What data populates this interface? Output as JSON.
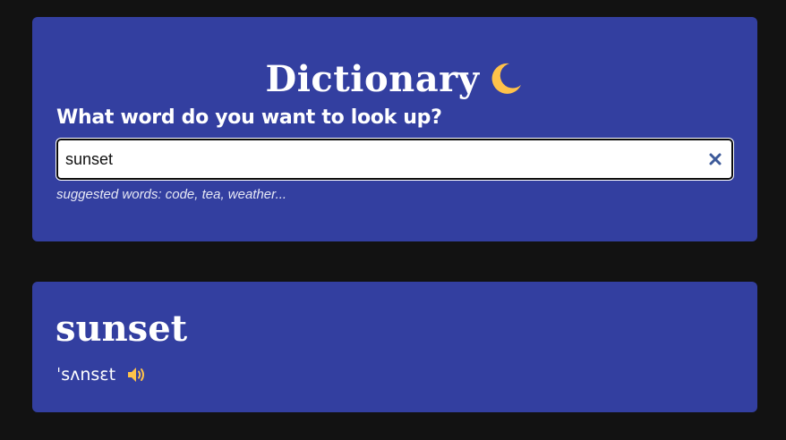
{
  "header": {
    "title": "Dictionary",
    "title_icon": "moon-icon"
  },
  "search": {
    "prompt": "What word do you want to look up?",
    "value": "sunset",
    "clear_icon": "close-icon",
    "suggestions": "suggested words: code, tea, weather..."
  },
  "result": {
    "word": "sunset",
    "phonetic": "ˈsʌnsɛt",
    "audio_icon": "speaker-icon"
  },
  "colors": {
    "page_background": "#121212",
    "card_background": "#333fa0",
    "accent": "#ffc24a",
    "clear_icon": "#3d5a99"
  }
}
